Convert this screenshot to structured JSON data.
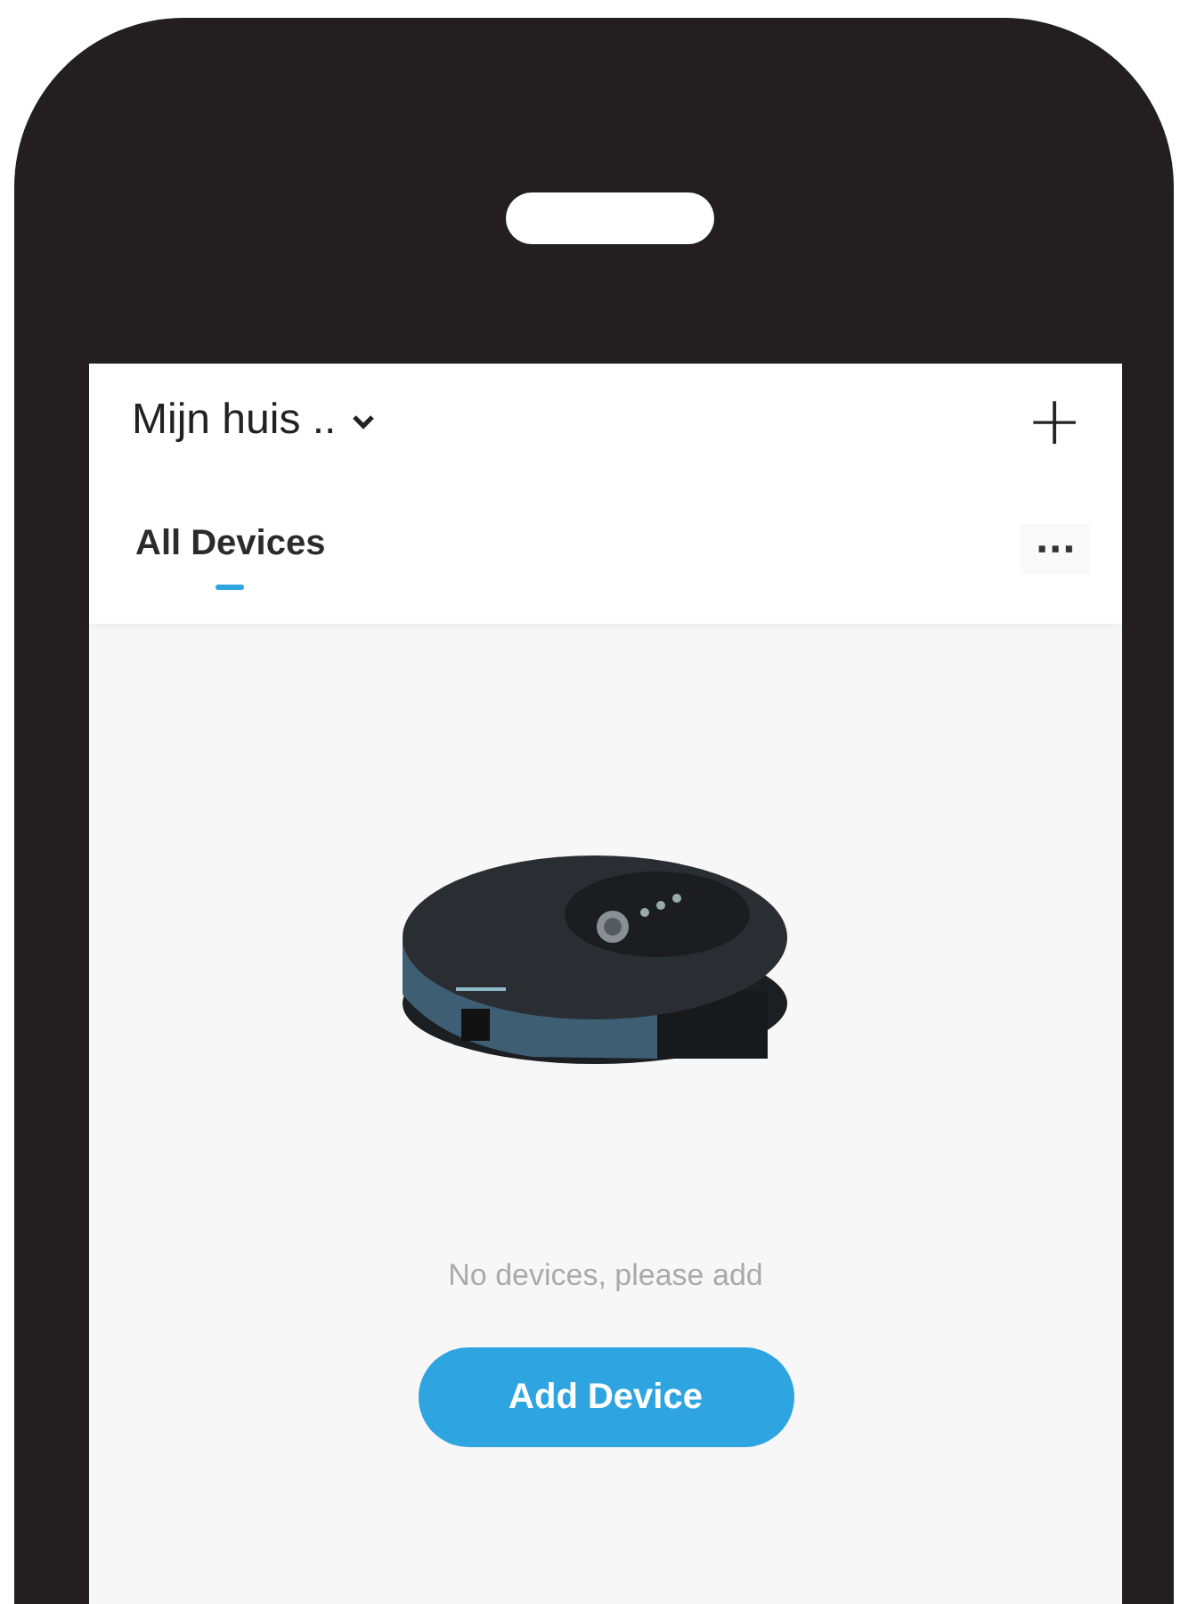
{
  "header": {
    "home_name": "Mijn huis ..",
    "add_symbol": "+"
  },
  "tabs": [
    {
      "label": "All Devices",
      "selected": true
    }
  ],
  "more_symbol": "···",
  "empty_state": {
    "kind": "picture",
    "message": "No devices, please add",
    "button": "Add Device"
  }
}
